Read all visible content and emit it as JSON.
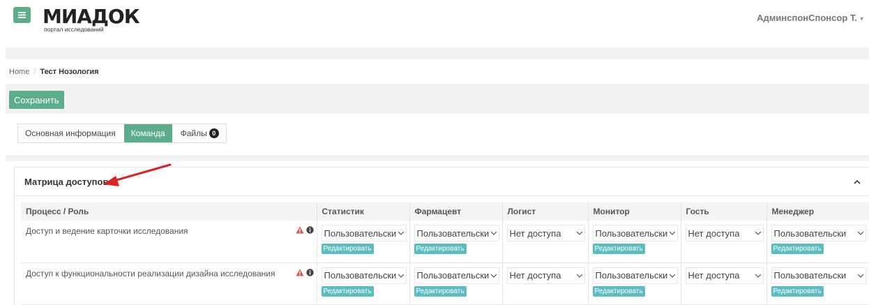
{
  "header": {
    "logo_text": "МИАДОК",
    "logo_subtitle": "портал исследований",
    "user_name": "АдминспонСпонсор Т."
  },
  "breadcrumb": {
    "home": "Home",
    "current": "Тест Нозология"
  },
  "toolbar": {
    "save_label": "Сохранить"
  },
  "tabs": [
    {
      "label": "Основная информация",
      "active": false
    },
    {
      "label": "Команда",
      "active": true
    },
    {
      "label": "Файлы",
      "active": false,
      "badge": "0"
    }
  ],
  "panel": {
    "title": "Матрица доступов"
  },
  "matrix": {
    "headers": [
      "Процесс / Роль",
      "Статистик",
      "Фармацевт",
      "Логист",
      "Монитор",
      "Гость",
      "Менеджер"
    ],
    "edit_label": "Редактировать",
    "rows": [
      {
        "process": "Доступ и ведение карточки исследования",
        "cells": [
          {
            "value": "Пользовательски",
            "editable": true
          },
          {
            "value": "Пользовательски",
            "editable": true
          },
          {
            "value": "Нет доступа",
            "editable": false
          },
          {
            "value": "Пользовательски",
            "editable": true
          },
          {
            "value": "Нет доступа",
            "editable": false
          },
          {
            "value": "Пользовательски",
            "editable": true
          }
        ]
      },
      {
        "process": "Доступ к функциональности реализации дизайна исследования",
        "cells": [
          {
            "value": "Пользовательски",
            "editable": true
          },
          {
            "value": "Пользовательски",
            "editable": true
          },
          {
            "value": "Нет доступа",
            "editable": false
          },
          {
            "value": "Пользовательски",
            "editable": true
          },
          {
            "value": "Нет доступа",
            "editable": false
          },
          {
            "value": "Пользовательски",
            "editable": true
          }
        ]
      }
    ]
  },
  "colors": {
    "accent": "#5cad8a",
    "edit": "#5bbcc2",
    "warning": "#d9534f",
    "arrow": "#e02020"
  },
  "icons": [
    "menu-icon",
    "chevron-down-icon",
    "chevron-up-icon",
    "warning-icon",
    "info-icon"
  ]
}
